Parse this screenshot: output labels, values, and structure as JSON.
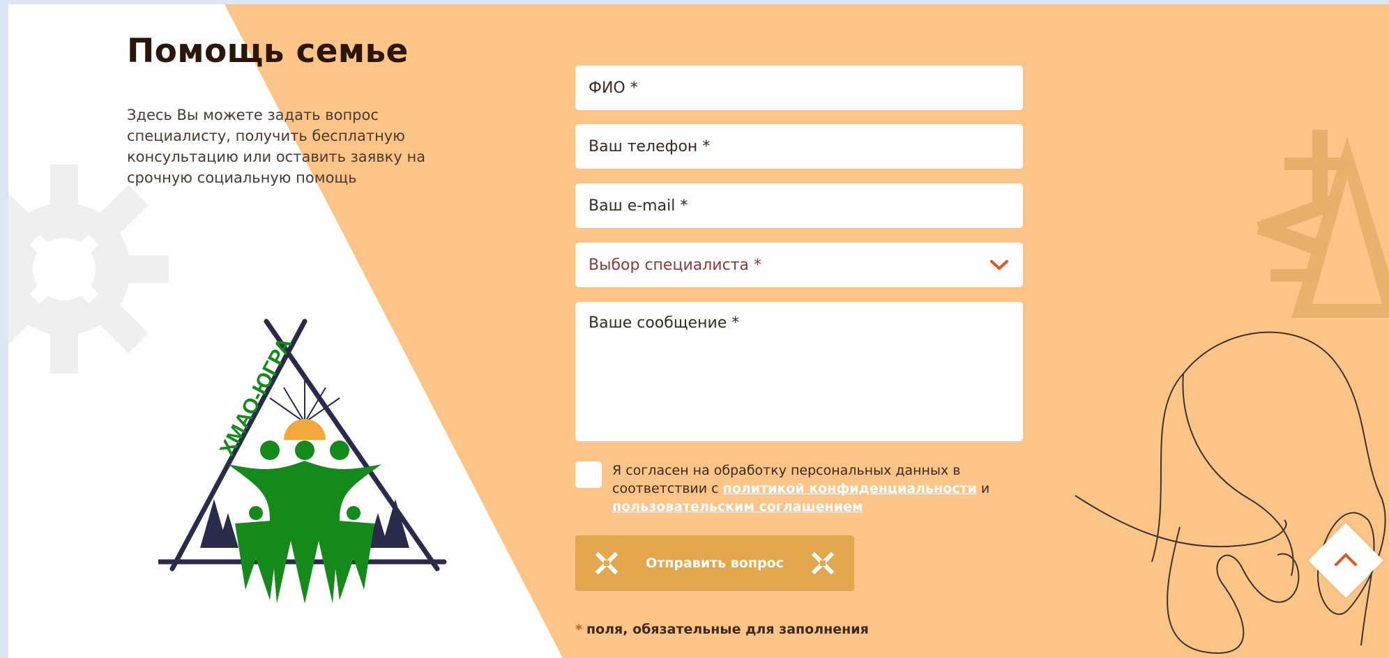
{
  "page": {
    "title": "Помощь семье",
    "lead": "Здесь Вы можете задать вопрос специалисту, получить бесплатную консультацию или оставить заявку на срочную социальную помощь"
  },
  "logo": {
    "text": "ХМАО-ЮГРА",
    "colors": {
      "green": "#138a1a",
      "navy": "#2a2a4a",
      "sun": "#f1a93a"
    }
  },
  "form": {
    "fio_placeholder": "ФИО *",
    "phone_placeholder": "Ваш телефон *",
    "email_placeholder": "Ваш e-mail *",
    "specialist_select": "Выбор специалиста *",
    "message_placeholder": "Ваше сообщение *",
    "consent": {
      "prefix": "Я согласен на обработку персональных данных в соответствии с ",
      "privacy_link": "политикой конфиденциальности",
      "and": " и ",
      "agreement_link": "пользовательским соглашением"
    },
    "submit_label": "Отправить вопрос",
    "required_star": "*",
    "required_note": "поля, обязательные для заполнения"
  },
  "colors": {
    "background": "#fcc487",
    "button": "#e3a74d",
    "accent": "#e0561e"
  },
  "icons": [
    "chevron-down-icon",
    "ornament-icon",
    "chevron-up-icon",
    "sun-ornament-icon",
    "mammoth-drawing"
  ]
}
